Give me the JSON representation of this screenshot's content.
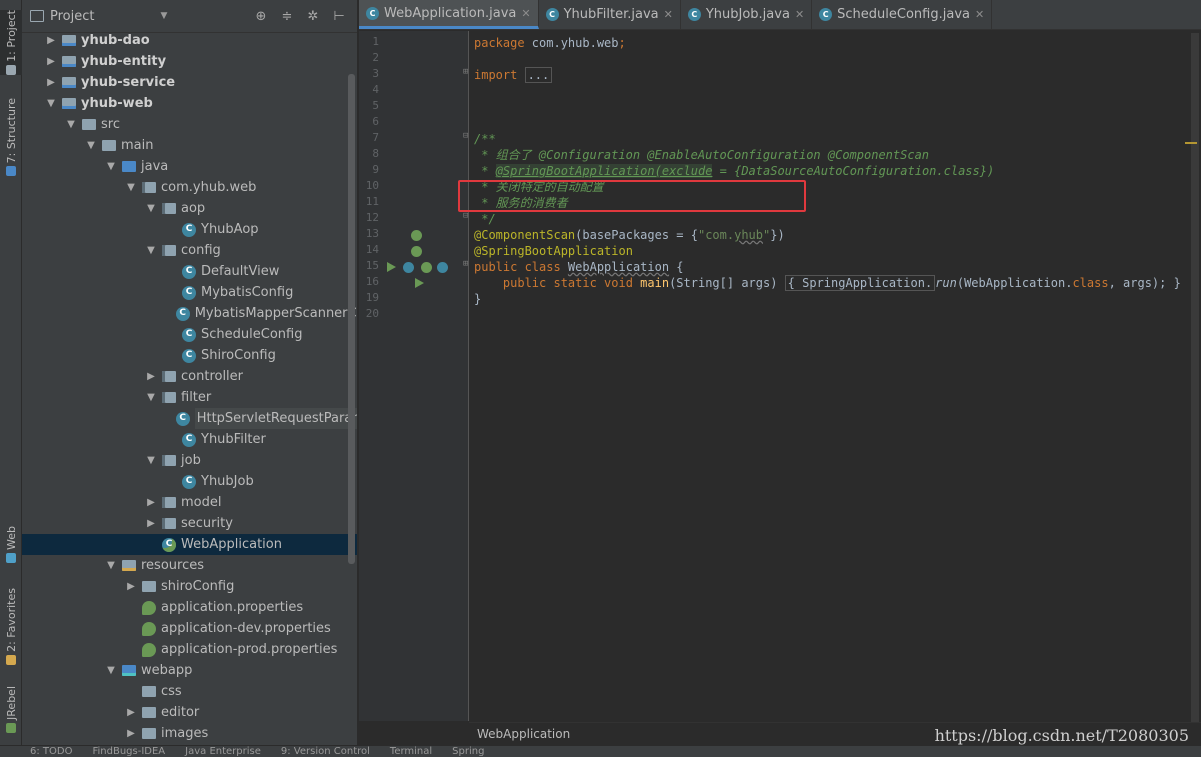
{
  "left_strip": {
    "tabs": [
      {
        "label": "1: Project",
        "icon": "project-icon"
      },
      {
        "label": "7: Structure",
        "icon": "structure-icon"
      },
      {
        "label": "Web",
        "icon": "web-icon"
      },
      {
        "label": "2: Favorites",
        "icon": "star-icon"
      },
      {
        "label": "JRebel",
        "icon": "jrebel-icon"
      }
    ]
  },
  "project_panel": {
    "title": "Project",
    "tools": [
      "target-icon",
      "collapse-icon",
      "gear-icon",
      "hide-icon"
    ],
    "tree": [
      {
        "label": "yhub-dao",
        "depth": 1,
        "arrow": "▶",
        "icon": "module",
        "bold": true
      },
      {
        "label": "yhub-entity",
        "depth": 1,
        "arrow": "▶",
        "icon": "module",
        "bold": true
      },
      {
        "label": "yhub-service",
        "depth": 1,
        "arrow": "▶",
        "icon": "module",
        "bold": true
      },
      {
        "label": "yhub-web",
        "depth": 1,
        "arrow": "▼",
        "icon": "module",
        "bold": true
      },
      {
        "label": "src",
        "depth": 2,
        "arrow": "▼",
        "icon": "folder"
      },
      {
        "label": "main",
        "depth": 3,
        "arrow": "▼",
        "icon": "folder"
      },
      {
        "label": "java",
        "depth": 4,
        "arrow": "▼",
        "icon": "src-folder"
      },
      {
        "label": "com.yhub.web",
        "depth": 5,
        "arrow": "▼",
        "icon": "pkg"
      },
      {
        "label": "aop",
        "depth": 6,
        "arrow": "▼",
        "icon": "pkg"
      },
      {
        "label": "YhubAop",
        "depth": 7,
        "arrow": "",
        "icon": "cls"
      },
      {
        "label": "config",
        "depth": 6,
        "arrow": "▼",
        "icon": "pkg"
      },
      {
        "label": "DefaultView",
        "depth": 7,
        "arrow": "",
        "icon": "cls"
      },
      {
        "label": "MybatisConfig",
        "depth": 7,
        "arrow": "",
        "icon": "cls"
      },
      {
        "label": "MybatisMapperScannerCo",
        "depth": 7,
        "arrow": "",
        "icon": "cls"
      },
      {
        "label": "ScheduleConfig",
        "depth": 7,
        "arrow": "",
        "icon": "cls"
      },
      {
        "label": "ShiroConfig",
        "depth": 7,
        "arrow": "",
        "icon": "cls"
      },
      {
        "label": "controller",
        "depth": 6,
        "arrow": "▶",
        "icon": "pkg"
      },
      {
        "label": "filter",
        "depth": 6,
        "arrow": "▼",
        "icon": "pkg"
      },
      {
        "label": "HttpServletRequestParameterWrapper",
        "depth": 7,
        "arrow": "",
        "icon": "cls",
        "hl": true
      },
      {
        "label": "YhubFilter",
        "depth": 7,
        "arrow": "",
        "icon": "cls"
      },
      {
        "label": "job",
        "depth": 6,
        "arrow": "▼",
        "icon": "pkg"
      },
      {
        "label": "YhubJob",
        "depth": 7,
        "arrow": "",
        "icon": "cls"
      },
      {
        "label": "model",
        "depth": 6,
        "arrow": "▶",
        "icon": "pkg"
      },
      {
        "label": "security",
        "depth": 6,
        "arrow": "▶",
        "icon": "pkg"
      },
      {
        "label": "WebApplication",
        "depth": 6,
        "arrow": "",
        "icon": "cls-spring",
        "selected": true
      },
      {
        "label": "resources",
        "depth": 4,
        "arrow": "▼",
        "icon": "res-folder"
      },
      {
        "label": "shiroConfig",
        "depth": 5,
        "arrow": "▶",
        "icon": "folder"
      },
      {
        "label": "application.properties",
        "depth": 5,
        "arrow": "",
        "icon": "props"
      },
      {
        "label": "application-dev.properties",
        "depth": 5,
        "arrow": "",
        "icon": "props"
      },
      {
        "label": "application-prod.properties",
        "depth": 5,
        "arrow": "",
        "icon": "props"
      },
      {
        "label": "webapp",
        "depth": 4,
        "arrow": "▼",
        "icon": "web-folder"
      },
      {
        "label": "css",
        "depth": 5,
        "arrow": "",
        "icon": "folder"
      },
      {
        "label": "editor",
        "depth": 5,
        "arrow": "▶",
        "icon": "folder"
      },
      {
        "label": "images",
        "depth": 5,
        "arrow": "▶",
        "icon": "folder"
      }
    ]
  },
  "editor": {
    "tabs": [
      {
        "label": "WebApplication.java",
        "active": true
      },
      {
        "label": "YhubFilter.java",
        "active": false
      },
      {
        "label": "YhubJob.java",
        "active": false
      },
      {
        "label": "ScheduleConfig.java",
        "active": false
      }
    ],
    "line_numbers": [
      "1",
      "2",
      "3",
      "4",
      "5",
      "6",
      "7",
      "8",
      "9",
      "10",
      "11",
      "12",
      "13",
      "14",
      "15",
      "16",
      "19",
      "20"
    ],
    "code_lines": [
      [
        {
          "t": "package ",
          "c": "kw"
        },
        {
          "t": "com.yhub.web",
          "c": ""
        },
        {
          "t": ";",
          "c": "kw"
        }
      ],
      [],
      [
        {
          "t": "import ",
          "c": "kw"
        },
        {
          "t": "...",
          "c": "fold-box"
        }
      ],
      [],
      [],
      [],
      [
        {
          "t": "/**",
          "c": "cm"
        }
      ],
      [
        {
          "t": " * 组合了 @Configuration @EnableAutoConfiguration @ComponentScan",
          "c": "cm"
        }
      ],
      [
        {
          "t": " * ",
          "c": "cm"
        },
        {
          "t": "@SpringBootApplication(exclude",
          "c": "cmh"
        },
        {
          "t": " = {DataSourceAutoConfiguration.class})",
          "c": "cm"
        }
      ],
      [
        {
          "t": " * 关闭特定的自动配置",
          "c": "cm"
        }
      ],
      [
        {
          "t": " * 服务的消费者",
          "c": "cm"
        }
      ],
      [
        {
          "t": " */",
          "c": "cm"
        }
      ],
      [
        {
          "t": "@ComponentScan",
          "c": "an"
        },
        {
          "t": "(basePackages = {",
          "c": ""
        },
        {
          "t": "\"com.",
          "c": "str"
        },
        {
          "t": "yhub",
          "c": "str under"
        },
        {
          "t": "\"",
          "c": "str"
        },
        {
          "t": "})",
          "c": ""
        }
      ],
      [
        {
          "t": "@SpringBootApplication",
          "c": "an"
        }
      ],
      [
        {
          "t": "public class ",
          "c": "kw"
        },
        {
          "t": "WebApplication",
          "c": "under"
        },
        {
          "t": " {",
          "c": ""
        }
      ],
      [
        {
          "t": "    public static void ",
          "c": "kw"
        },
        {
          "t": "main",
          "c": "fn"
        },
        {
          "t": "(String[] args) ",
          "c": ""
        },
        {
          "t": "{ SpringApplication.",
          "c": "fold-box"
        },
        {
          "t": "run",
          "c": "it"
        },
        {
          "t": "(WebApplication.",
          "c": ""
        },
        {
          "t": "class",
          "c": "kw"
        },
        {
          "t": ", args); }",
          "c": ""
        }
      ],
      [
        {
          "t": "}",
          "c": ""
        }
      ],
      []
    ],
    "breadcrumb": "WebApplication",
    "watermark": "https://blog.csdn.net/T2080305"
  },
  "bottom_bar": {
    "items": [
      "6: TODO",
      "FindBugs-IDEA",
      "Java Enterprise",
      "9: Version Control",
      "Terminal",
      "Spring"
    ]
  }
}
